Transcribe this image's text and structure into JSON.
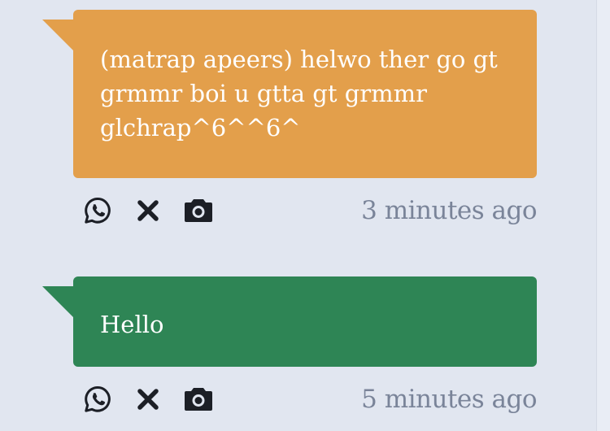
{
  "messages": [
    {
      "text": "(matrap apeers) helwo ther go gt grmmr boi u gtta gt grmmr glchrap^6^^6^",
      "color": "#e39f4b",
      "timestamp": "3 minutes ago",
      "actions": [
        "whatsapp-icon",
        "close-icon",
        "camera-icon"
      ]
    },
    {
      "text": "Hello",
      "color": "#2e8555",
      "timestamp": "5 minutes ago",
      "actions": [
        "whatsapp-icon",
        "close-icon",
        "camera-icon"
      ]
    }
  ],
  "colors": {
    "background": "#e1e6f0",
    "timestamp": "#7a8499",
    "icon": "#1c1f26"
  }
}
